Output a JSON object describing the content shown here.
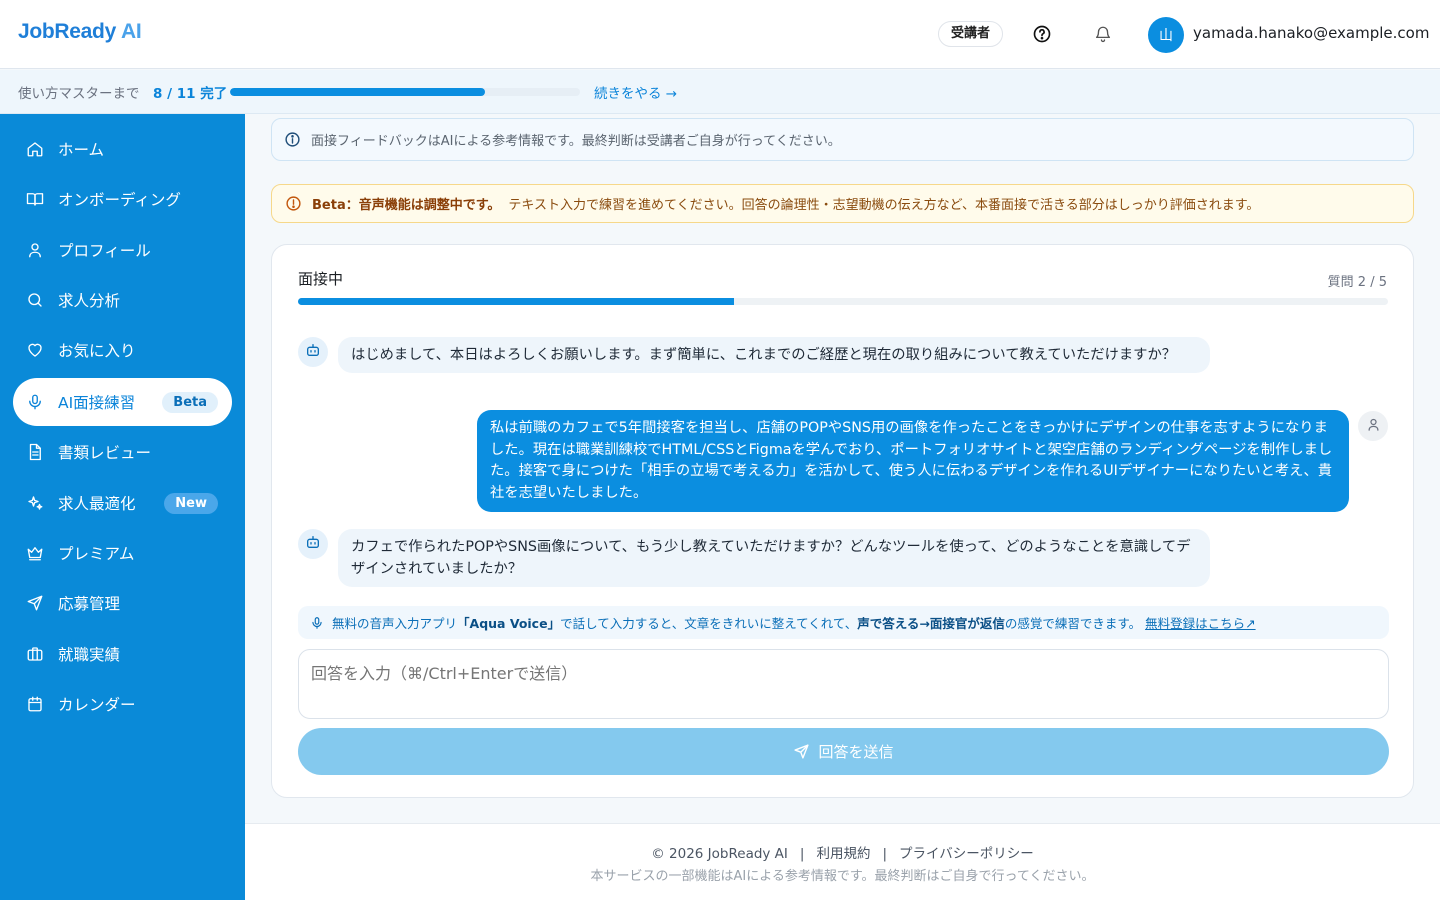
{
  "app": {
    "logo_main": "JobReady",
    "logo_ai": "AI"
  },
  "header": {
    "role_badge": "受講者",
    "avatar_initial": "山",
    "user_email": "yamada.hanako@example.com",
    "icons": [
      "help-icon",
      "bell-icon"
    ]
  },
  "onboarding_progress": {
    "label": "使い方マスターまで",
    "count": "8 / 11 完了",
    "completed": 8,
    "total": 11,
    "continue_link": "続きをやる →"
  },
  "sidebar": {
    "items": [
      {
        "label": "ホーム",
        "icon": "home-icon",
        "active": false,
        "badge": ""
      },
      {
        "label": "オンボーディング",
        "icon": "book-icon",
        "active": false,
        "badge": ""
      },
      {
        "label": "プロフィール",
        "icon": "user-icon",
        "active": false,
        "badge": ""
      },
      {
        "label": "求人分析",
        "icon": "search-icon",
        "active": false,
        "badge": ""
      },
      {
        "label": "お気に入り",
        "icon": "heart-icon",
        "active": false,
        "badge": ""
      },
      {
        "label": "AI面接練習",
        "icon": "mic-icon",
        "active": true,
        "badge": "Beta"
      },
      {
        "label": "書類レビュー",
        "icon": "document-icon",
        "active": false,
        "badge": ""
      },
      {
        "label": "求人最適化",
        "icon": "sparkles-icon",
        "active": false,
        "badge": "New"
      },
      {
        "label": "プレミアム",
        "icon": "crown-icon",
        "active": false,
        "badge": ""
      },
      {
        "label": "応募管理",
        "icon": "send-icon",
        "active": false,
        "badge": ""
      },
      {
        "label": "就職実績",
        "icon": "briefcase-icon",
        "active": false,
        "badge": ""
      },
      {
        "label": "カレンダー",
        "icon": "calendar-icon",
        "active": false,
        "badge": ""
      }
    ]
  },
  "notices": {
    "info": "面接フィードバックはAIによる参考情報です。最終判断は受講者ご自身が行ってください。",
    "beta_strong": "Beta：音声機能は調整中です。",
    "beta_text": "テキスト入力で練習を進めてください。回答の論理性・志望動機の伝え方など、本番面接で活きる部分はしっかり評価されます。"
  },
  "interview": {
    "title": "面接中",
    "step": "質問 2 / 5",
    "current_question": 2,
    "total_questions": 5,
    "messages": [
      {
        "role": "bot",
        "text": "はじめまして、本日はよろしくお願いします。まず簡単に、これまでのご経歴と現在の取り組みについて教えていただけますか？"
      },
      {
        "role": "user",
        "text": "私は前職のカフェで5年間接客を担当し、店舗のPOPやSNS用の画像を作ったことをきっかけにデザインの仕事を志すようになりました。現在は職業訓練校でHTML/CSSとFigmaを学んでおり、ポートフォリオサイトと架空店舗のランディングページを制作しました。接客で身につけた「相手の立場で考える力」を活かして、使う人に伝わるデザインを作れるUIデザイナーになりたいと考え、貴社を志望いたしました。"
      },
      {
        "role": "bot",
        "text": "カフェで作られたPOPやSNS画像について、もう少し教えていただけますか？どんなツールを使って、どのようなことを意識してデザインされていましたか？"
      }
    ],
    "voice_tip": {
      "pre": "無料の音声入力アプリ",
      "app_name": "「Aqua Voice」",
      "mid": "で話して入力すると、文章をきれいに整えてくれて、",
      "highlight": "声で答える→面接官が返信",
      "post": "の感覚で練習できます。",
      "link": "無料登録はこちら↗"
    },
    "answer_placeholder": "回答を入力（⌘/Ctrl+Enterで送信）",
    "send_label": "回答を送信"
  },
  "footer": {
    "copyright": "© 2026 JobReady AI",
    "terms": "利用規約",
    "privacy": "プライバシーポリシー",
    "separator": "|",
    "note": "本サービスの一部機能はAIによる参考情報です。最終判断はご自身で行ってください。"
  },
  "colors": {
    "brand": "#0a8ad8",
    "accent": "#0b8ee0",
    "warning_bg": "#fffbeb"
  }
}
